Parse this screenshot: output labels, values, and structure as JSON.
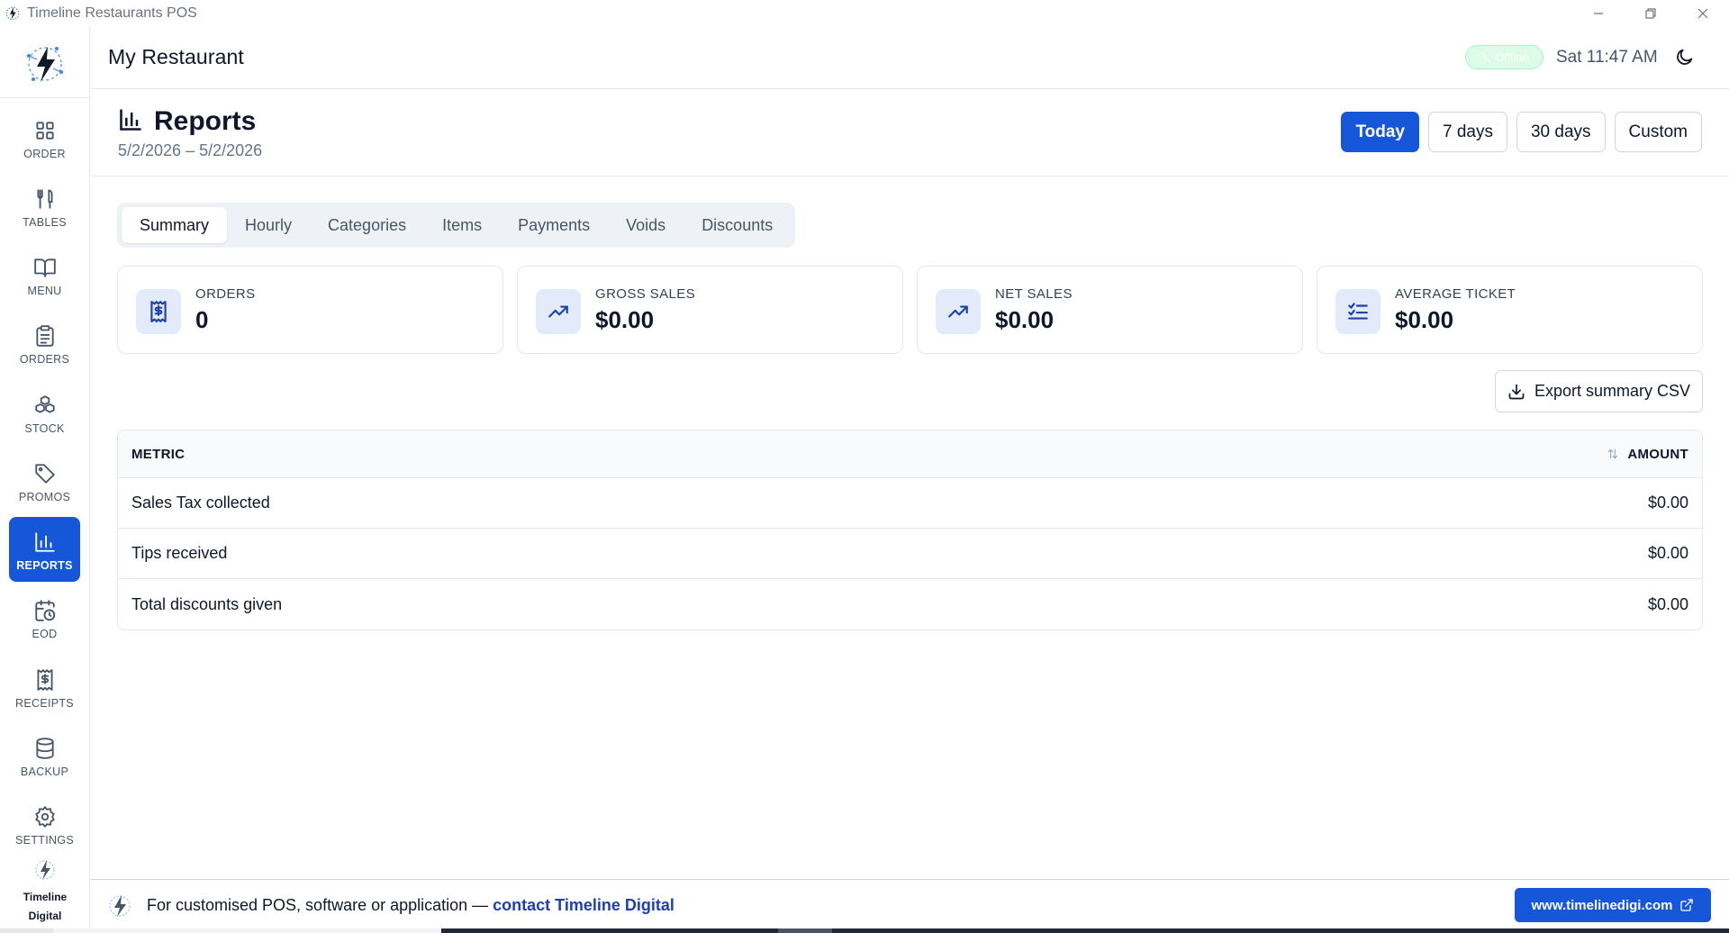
{
  "window": {
    "title": "Timeline Restaurants POS",
    "icons": {
      "app": "logo-icon",
      "minimize": "minimize-icon",
      "maximize": "restore-icon",
      "close": "close-icon"
    }
  },
  "sidebar": {
    "items": [
      {
        "label": "ORDER",
        "icon": "grid-icon",
        "active": false
      },
      {
        "label": "TABLES",
        "icon": "utensils-icon",
        "active": false
      },
      {
        "label": "MENU",
        "icon": "book-icon",
        "active": false
      },
      {
        "label": "ORDERS",
        "icon": "clipboard-icon",
        "active": false
      },
      {
        "label": "STOCK",
        "icon": "boxes-icon",
        "active": false
      },
      {
        "label": "PROMOS",
        "icon": "tag-icon",
        "active": false
      },
      {
        "label": "REPORTS",
        "icon": "bar-chart-icon",
        "active": true
      },
      {
        "label": "EOD",
        "icon": "calendar-clock-icon",
        "active": false
      },
      {
        "label": "RECEIPTS",
        "icon": "receipt-icon",
        "active": false
      },
      {
        "label": "BACKUP",
        "icon": "database-icon",
        "active": false
      },
      {
        "label": "SETTINGS",
        "icon": "gear-icon",
        "active": false
      }
    ],
    "brand_line1": "Timeline",
    "brand_line2": "Digital"
  },
  "header": {
    "restaurant_name": "My Restaurant",
    "status": "Offline",
    "time": "Sat 11:47 AM"
  },
  "page": {
    "title": "Reports",
    "range": "5/2/2026 – 5/2/2026",
    "range_buttons": [
      "Today",
      "7 days",
      "30 days",
      "Custom"
    ],
    "active_range": "Today"
  },
  "tabs": [
    "Summary",
    "Hourly",
    "Categories",
    "Items",
    "Payments",
    "Voids",
    "Discounts"
  ],
  "active_tab": "Summary",
  "cards": [
    {
      "label": "ORDERS",
      "value": "0",
      "icon": "dollar-receipt-icon"
    },
    {
      "label": "GROSS SALES",
      "value": "$0.00",
      "icon": "trending-up-icon"
    },
    {
      "label": "NET SALES",
      "value": "$0.00",
      "icon": "trending-up-icon"
    },
    {
      "label": "AVERAGE TICKET",
      "value": "$0.00",
      "icon": "list-checks-icon"
    }
  ],
  "export_label": "Export summary CSV",
  "table": {
    "col_metric": "METRIC",
    "col_amount": "AMOUNT",
    "rows": [
      {
        "metric": "Sales Tax collected",
        "amount": "$0.00"
      },
      {
        "metric": "Tips received",
        "amount": "$0.00"
      },
      {
        "metric": "Total discounts given",
        "amount": "$0.00"
      }
    ]
  },
  "footer": {
    "text": "For customised POS, software or application — ",
    "link": "contact Timeline Digital",
    "button": "www.timelinedigi.com"
  },
  "colors": {
    "accent": "#1657d9",
    "text": "#0f172a",
    "muted": "#64748b",
    "card_icon_bg": "#e3ebfb"
  }
}
